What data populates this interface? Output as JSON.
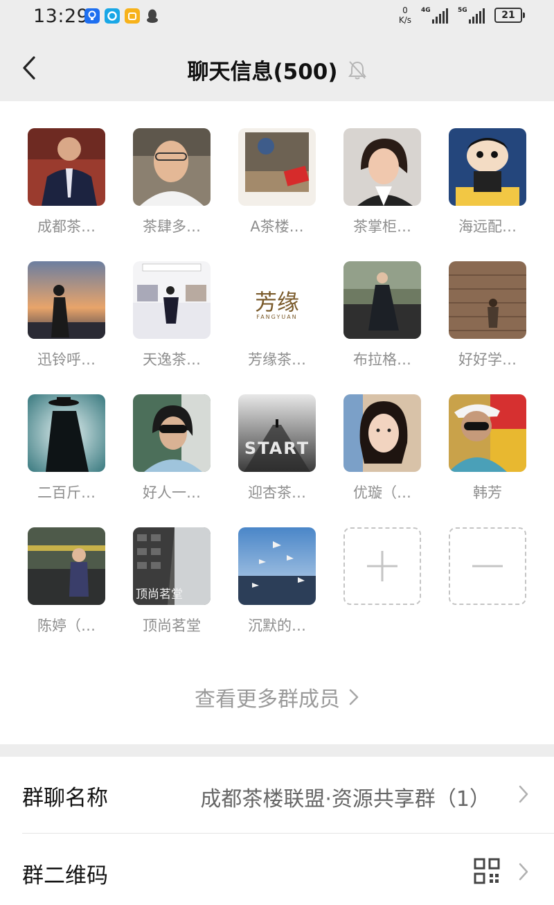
{
  "status_bar": {
    "time": "13:29",
    "net_speed_value": "0",
    "net_speed_unit": "K/s",
    "signal1_label": "4G",
    "signal2_label": "5G",
    "battery": "21"
  },
  "header": {
    "title": "聊天信息(500)"
  },
  "members": [
    {
      "name": "成都茶…"
    },
    {
      "name": "茶肆多…"
    },
    {
      "name": "A茶楼…"
    },
    {
      "name": "茶掌柜…"
    },
    {
      "name": "海远配…"
    },
    {
      "name": "迅铃呼…"
    },
    {
      "name": "天逸茶…"
    },
    {
      "name": "芳缘茶…",
      "avatar_text": "芳缘",
      "avatar_subtext": "FANGYUAN"
    },
    {
      "name": "布拉格…"
    },
    {
      "name": "好好学…"
    },
    {
      "name": "二百斤…"
    },
    {
      "name": "好人一…"
    },
    {
      "name": "迎杏茶…",
      "avatar_text": "START"
    },
    {
      "name": "优璇（…"
    },
    {
      "name": "韩芳"
    },
    {
      "name": "陈婷（…"
    },
    {
      "name": "顶尚茗堂",
      "avatar_text": "顶尚茗堂"
    },
    {
      "name": "沉默的…"
    }
  ],
  "more_members_label": "查看更多群成员",
  "settings": {
    "group_name_label": "群聊名称",
    "group_name_value": "成都茶楼联盟·资源共享群（1）",
    "qr_label": "群二维码"
  }
}
